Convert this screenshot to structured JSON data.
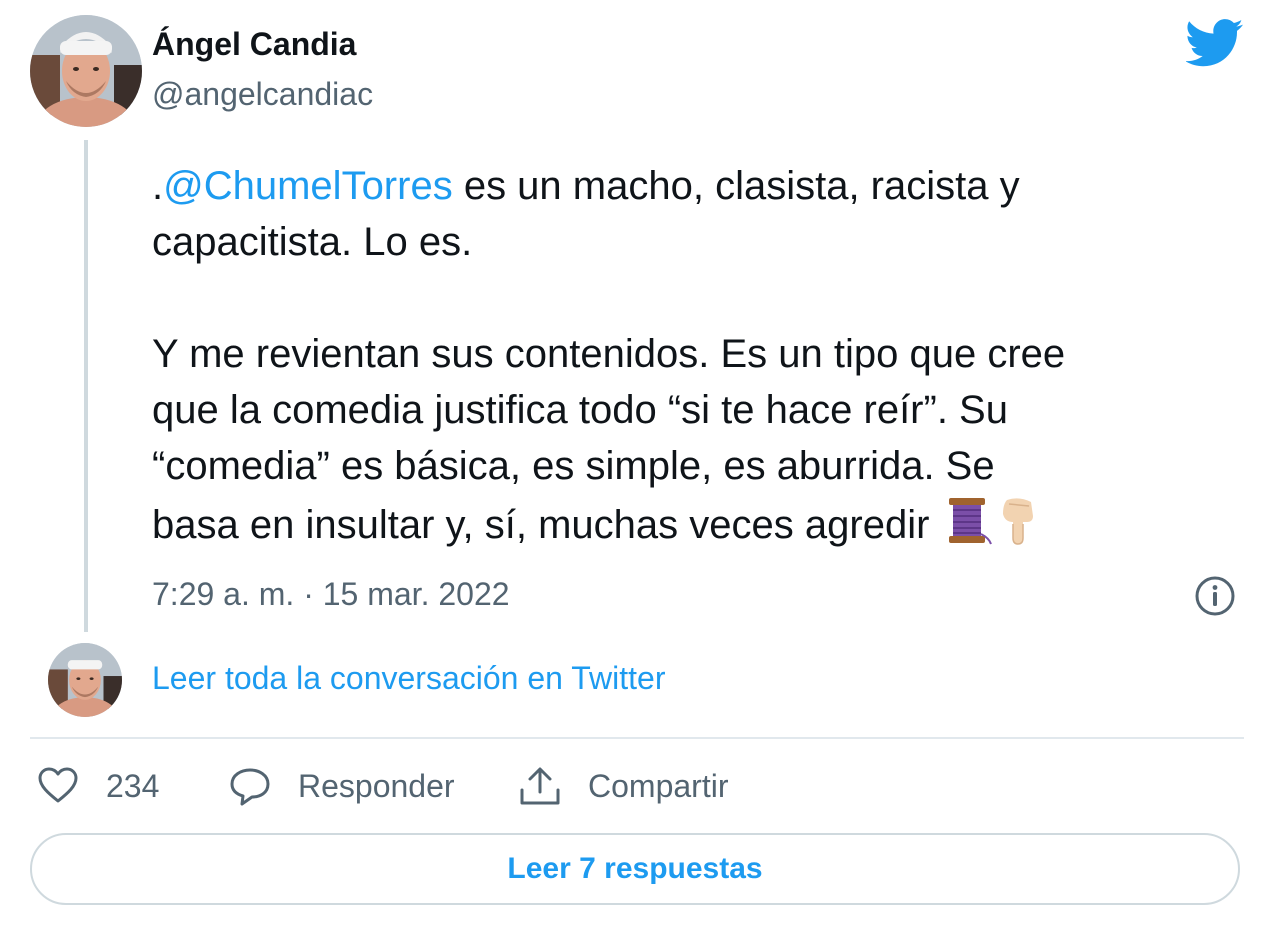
{
  "author": {
    "display_name": "Ángel Candia",
    "handle": "@angelcandiac"
  },
  "tweet": {
    "mention": "@ChumelTorres",
    "line1_prefix": ".",
    "line1_rest": " es un macho, clasista, racista y",
    "line2": "capacitista. Lo es.",
    "line3": "Y me revientan sus contenidos. Es un tipo que cree",
    "line4": "que la comedia justifica todo “si te hace reír”. Su",
    "line5": "“comedia” es básica, es simple, es aburrida. Se",
    "line6": "basa en insultar y, sí, muchas veces agredir",
    "emojis": [
      "thread-spool-icon",
      "pointing-down-hand-icon"
    ],
    "timestamp": "7:29 a. m. · 15 mar. 2022"
  },
  "conversation_link": "Leer toda la conversación en Twitter",
  "actions": {
    "like_count": "234",
    "reply_label": "Responder",
    "share_label": "Compartir"
  },
  "read_replies_label": "Leer 7 respuestas",
  "colors": {
    "accent": "#1d9bf0",
    "text": "#0f1419",
    "secondary": "#536471",
    "border": "#cfd9de"
  },
  "icons": [
    "twitter-bird-icon",
    "info-icon",
    "heart-icon",
    "speech-bubble-icon",
    "share-upload-icon"
  ]
}
